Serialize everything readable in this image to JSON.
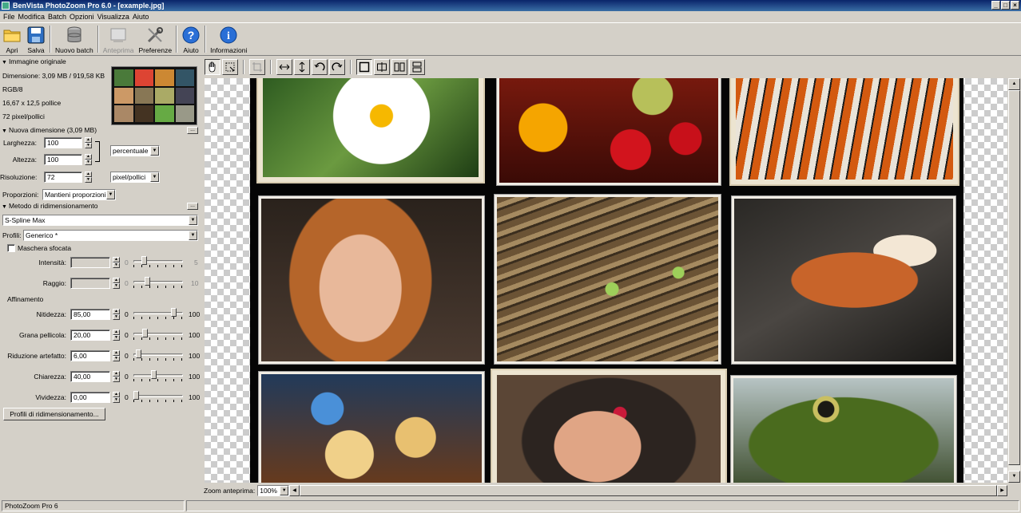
{
  "window": {
    "title": "BenVista PhotoZoom Pro 6.0 - [example.jpg]"
  },
  "menu": [
    "File",
    "Modifica",
    "Batch",
    "Opzioni",
    "Visualizza",
    "Aiuto"
  ],
  "toolbar": {
    "open": "Apri",
    "save": "Salva",
    "batch": "Nuovo batch",
    "preview": "Anteprima",
    "prefs": "Preferenze",
    "help": "Aiuto",
    "info": "Informazioni"
  },
  "original": {
    "header": "Immagine originale",
    "size": "Dimensione: 3,09 MB / 919,58 KB",
    "mode": "RGB/8",
    "dims": "16,67 x 12,5 pollice",
    "res": "72 pixel/pollici"
  },
  "newsize": {
    "header": "Nuova dimensione (3,09 MB)",
    "width_label": "Larghezza:",
    "width_value": "100",
    "height_label": "Altezza:",
    "height_value": "100",
    "unit": "percentuale",
    "res_label": "Risoluzione:",
    "res_value": "72",
    "res_unit": "pixel/pollici",
    "prop_label": "Proporzioni:",
    "prop_value": "Mantieni proporzioni"
  },
  "method": {
    "header": "Metodo di ridimensionamento",
    "algorithm": "S-Spline Max",
    "profile_label": "Profili:",
    "profile_value": "Generico *"
  },
  "mask": {
    "header": "Maschera sfocata",
    "intensity_label": "Intensità:",
    "intensity_min": "0",
    "intensity_max": "5",
    "radius_label": "Raggio:",
    "radius_min": "0",
    "radius_max": "10"
  },
  "refine": {
    "header": "Affinamento",
    "rows": [
      {
        "label": "Nitidezza:",
        "value": "85,00",
        "min": "0",
        "max": "100",
        "level": 0.85
      },
      {
        "label": "Grana pellicola:",
        "value": "20,00",
        "min": "0",
        "max": "100",
        "level": 0.2
      },
      {
        "label": "Riduzione artefatto:",
        "value": "6,00",
        "min": "0",
        "max": "100",
        "level": 0.06
      },
      {
        "label": "Chiarezza:",
        "value": "40,00",
        "min": "0",
        "max": "100",
        "level": 0.4
      },
      {
        "label": "Vividezza:",
        "value": "0,00",
        "min": "0",
        "max": "100",
        "level": 0.0
      }
    ],
    "profiles_button": "Profili di ridimensionamento..."
  },
  "zoom": {
    "label": "Zoom anteprima:",
    "value": "100%"
  },
  "status": {
    "text": "PhotoZoom Pro 6"
  },
  "more_button": "..."
}
